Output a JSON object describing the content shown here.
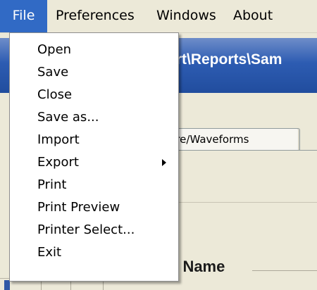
{
  "menubar": {
    "items": [
      "File",
      "Preferences",
      "Windows",
      "About"
    ]
  },
  "background": {
    "window_title": "ort\\Reports\\Sam",
    "tab_label": "sure/Waveforms",
    "group_label": "t Name"
  },
  "file_menu": {
    "items": [
      {
        "label": "Open"
      },
      {
        "label": "Save"
      },
      {
        "label": "Close"
      },
      {
        "label": "Save as..."
      },
      {
        "label": "Import"
      },
      {
        "label": "Export",
        "submenu": true
      },
      {
        "label": "Print"
      },
      {
        "label": "Print Preview"
      },
      {
        "label": "Printer Select..."
      },
      {
        "label": "Exit"
      }
    ]
  },
  "colors": {
    "menu_highlight": "#316ac5",
    "title_bar": "#2d5cb2",
    "face": "#ece9d8"
  }
}
